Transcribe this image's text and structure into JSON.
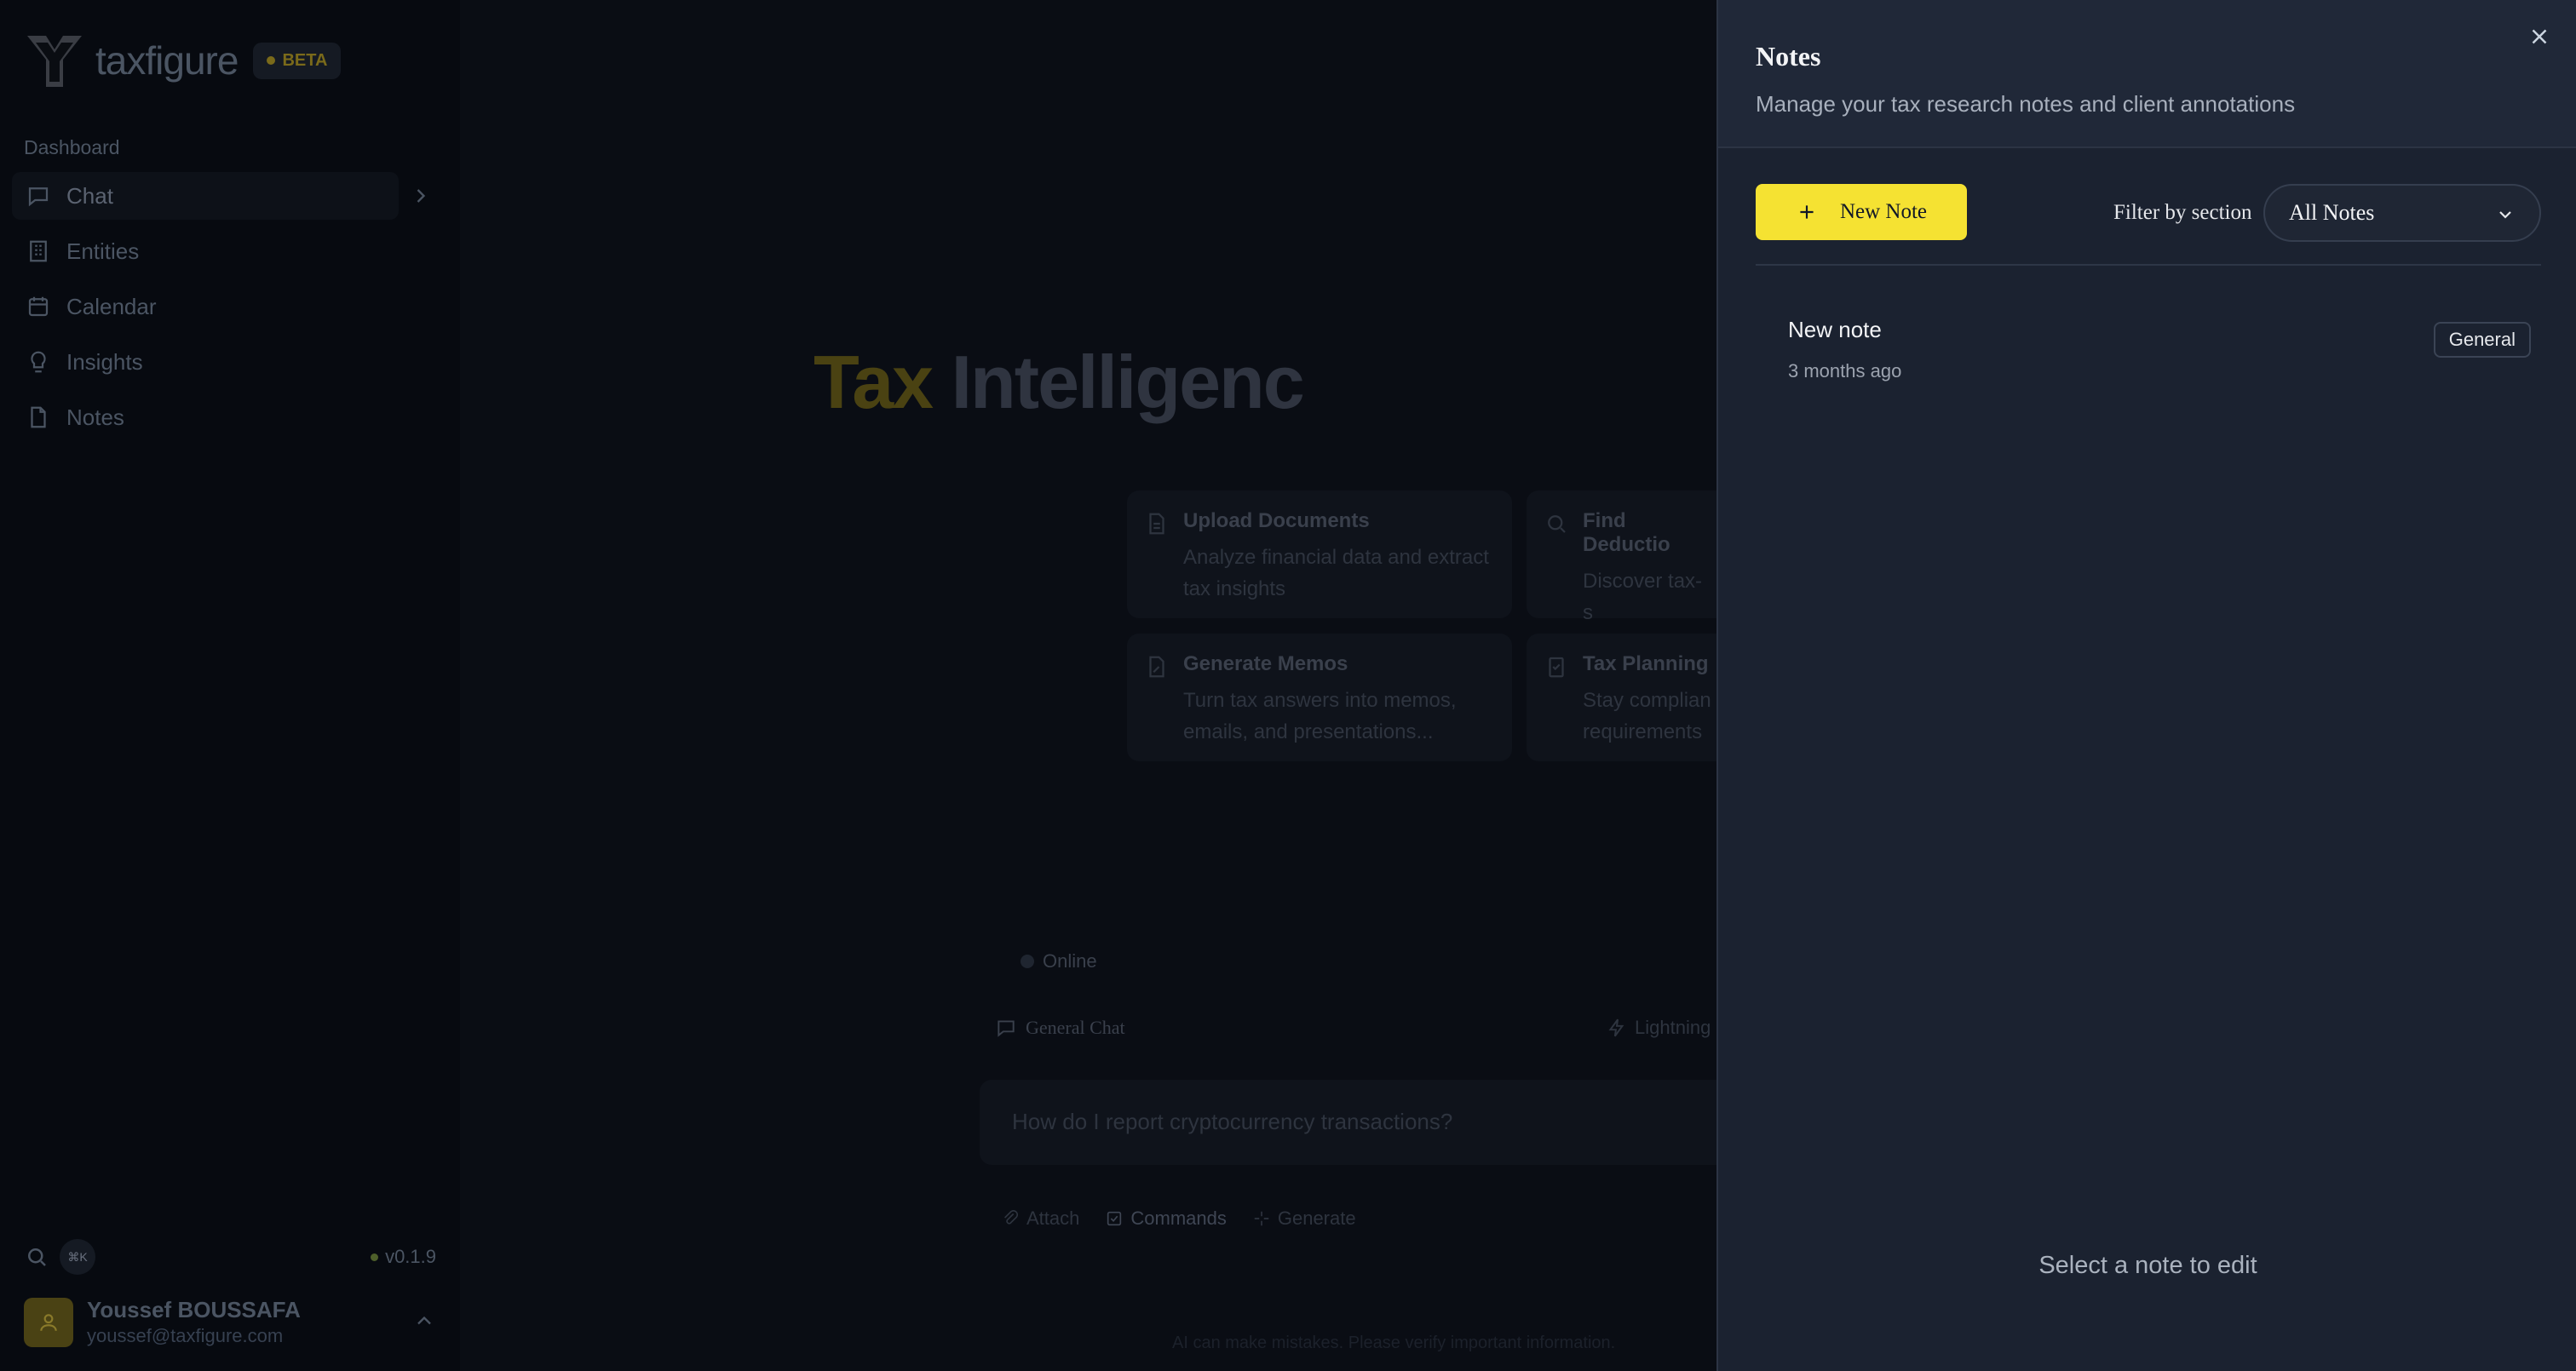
{
  "app": {
    "name": "taxfigure",
    "beta_label": "BETA",
    "version": "v0.1.9",
    "shortcut": "⌘K"
  },
  "sidebar": {
    "section_label": "Dashboard",
    "items": [
      {
        "label": "Chat",
        "icon": "chat-icon",
        "active": true
      },
      {
        "label": "Entities",
        "icon": "building-icon"
      },
      {
        "label": "Calendar",
        "icon": "calendar-icon"
      },
      {
        "label": "Insights",
        "icon": "lightbulb-icon"
      },
      {
        "label": "Notes",
        "icon": "file-icon"
      }
    ]
  },
  "user": {
    "name": "Youssef BOUSSAFA",
    "email": "youssef@taxfigure.com"
  },
  "main": {
    "hero_part1": "Tax",
    "hero_part2": "Intelligenc",
    "cards": [
      {
        "title": "Upload Documents",
        "desc": "Analyze financial data and extract tax insights"
      },
      {
        "title": "Find Deductio",
        "desc": "Discover tax-s opportunities"
      },
      {
        "title": "Generate Memos",
        "desc": "Turn tax answers into memos, emails, and presentations..."
      },
      {
        "title": "Tax Planning",
        "desc": "Stay complian requirements"
      }
    ],
    "status": "Online",
    "chat_mode": "General Chat",
    "speed_mode": "Lightning",
    "input_placeholder": "How do I report cryptocurrency transactions?",
    "tools": {
      "attach": "Attach",
      "commands": "Commands",
      "generate": "Generate"
    },
    "disclaimer": "AI can make mistakes. Please verify important information."
  },
  "notes_panel": {
    "title": "Notes",
    "subtitle": "Manage your tax research notes and client annotations",
    "new_button": "New Note",
    "filter_label": "Filter by section",
    "filter_value": "All Notes",
    "notes": [
      {
        "title": "New note",
        "time": "3 months ago",
        "tag": "General"
      }
    ],
    "empty_state": "Select a note to edit"
  },
  "colors": {
    "accent": "#f5e232",
    "panel_bg": "#1b2230",
    "page_bg": "#0b0f17"
  }
}
